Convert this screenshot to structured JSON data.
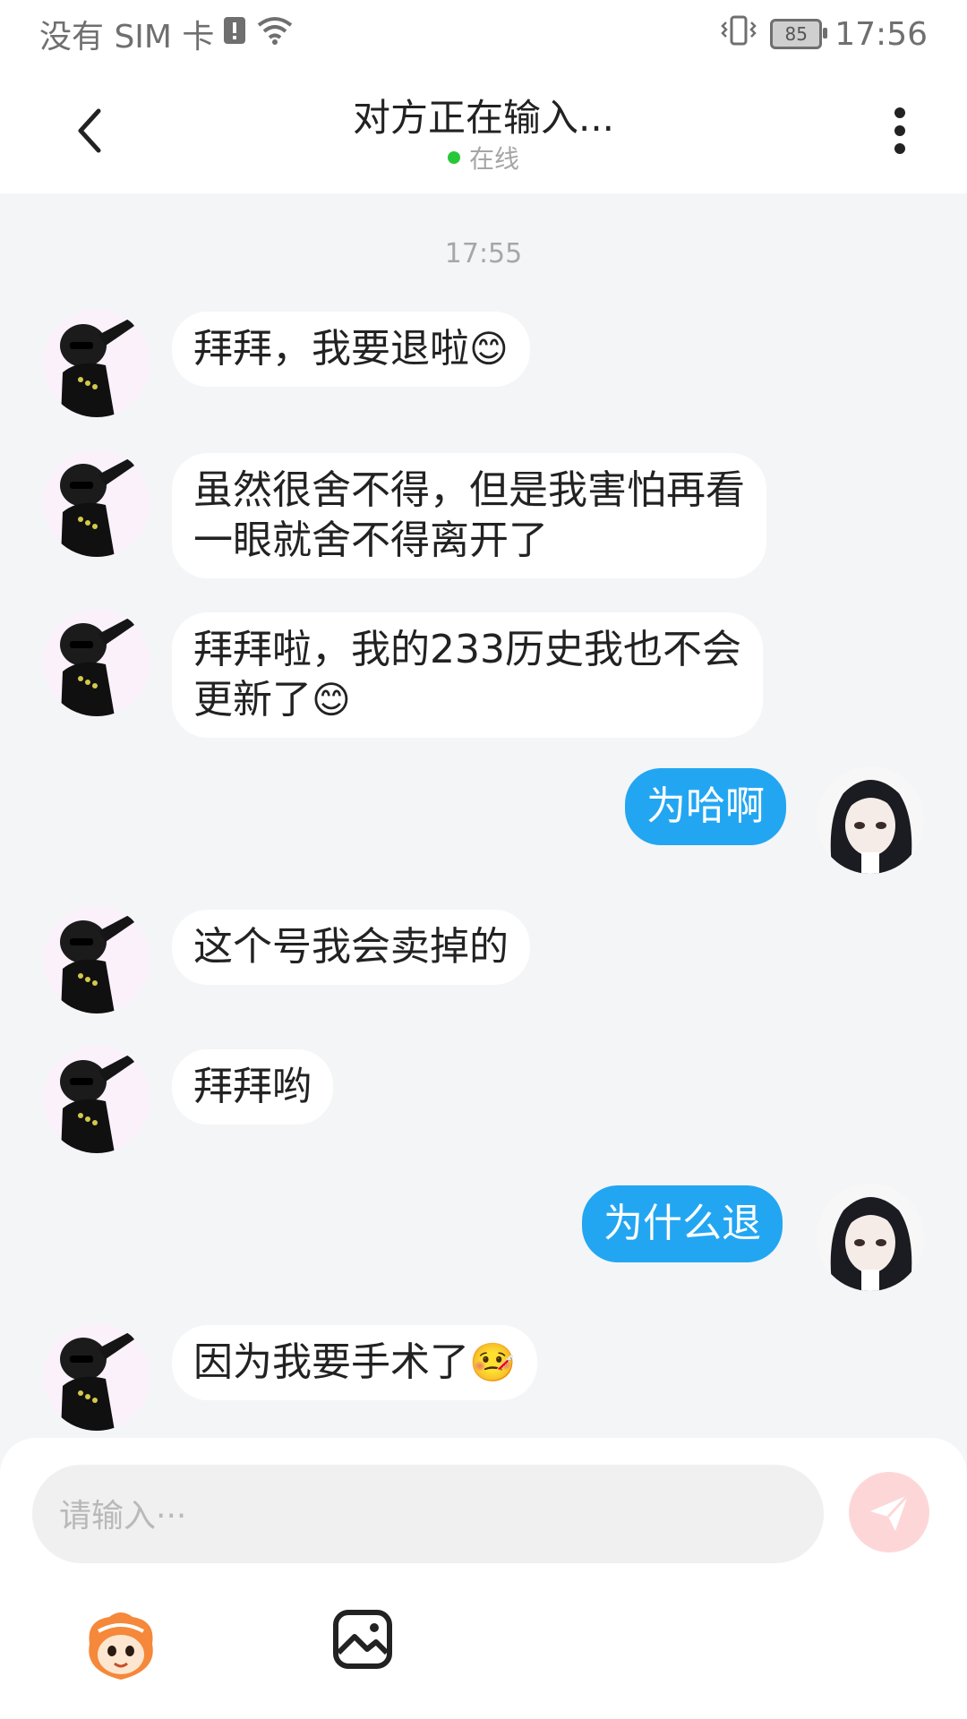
{
  "status_bar": {
    "carrier": "没有 SIM 卡",
    "battery": "85",
    "time": "17:56"
  },
  "header": {
    "title": "对方正在输入...",
    "status": "在线"
  },
  "chat": {
    "timestamp": "17:55",
    "messages": [
      {
        "side": "in",
        "lines": [
          "拜拜，我要退啦"
        ],
        "emoji": "smile"
      },
      {
        "side": "in",
        "lines": [
          "虽然很舍不得，但是我害怕再看",
          "一眼就舍不得离开了"
        ]
      },
      {
        "side": "in",
        "lines": [
          "拜拜啦，我的233历史我也不会",
          "更新了"
        ],
        "emoji": "smile"
      },
      {
        "side": "out",
        "lines": [
          "为哈啊"
        ]
      },
      {
        "side": "in",
        "lines": [
          "这个号我会卖掉的"
        ]
      },
      {
        "side": "in",
        "lines": [
          "拜拜哟"
        ]
      },
      {
        "side": "out",
        "lines": [
          "为什么退"
        ]
      },
      {
        "side": "in",
        "lines": [
          "因为我要手术了"
        ],
        "emoji": "sick"
      }
    ]
  },
  "input": {
    "placeholder": "请输入···"
  },
  "colors": {
    "accent_blue": "#23a6f2",
    "online_green": "#27c73a",
    "send_disabled": "#fdd7d7"
  },
  "icons": [
    "back-icon",
    "more-icon",
    "send-icon",
    "mascot-icon",
    "image-icon",
    "smile-emoji-icon",
    "sick-emoji-icon",
    "wifi-icon",
    "alert-icon",
    "vibrate-icon"
  ]
}
